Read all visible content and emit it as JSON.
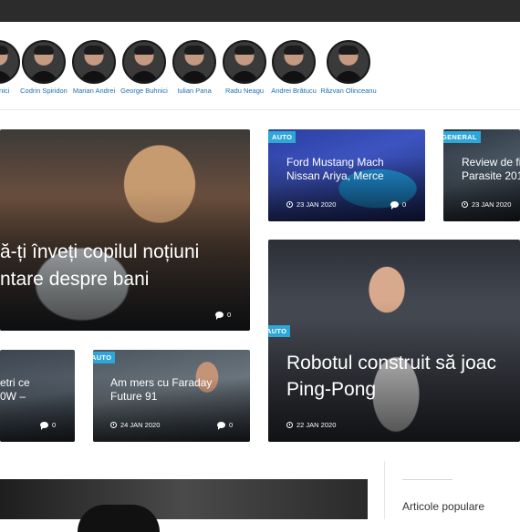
{
  "authors": [
    {
      "name": "Buhnici"
    },
    {
      "name": "Codrin Spiridon"
    },
    {
      "name": "Marian Andrei"
    },
    {
      "name": "George Buhnici"
    },
    {
      "name": "Iulian Pana"
    },
    {
      "name": "Radu Neagu"
    },
    {
      "name": "Andrei Brătucu"
    },
    {
      "name": "Răzvan Olinceanu"
    }
  ],
  "articles": {
    "main": {
      "title_line1": "ă-ți înveți copilul noțiuni",
      "title_line2": "ntare despre bani",
      "comments": "0"
    },
    "ford": {
      "tag": "AUTO",
      "title_line1": "Ford Mustang Mach",
      "title_line2": "Nissan Ariya, Merce",
      "date": "23 JAN 2020",
      "comments": "0"
    },
    "general": {
      "tag": "GENERAL",
      "title_line1": "Review de fi",
      "title_line2": "Parasite 201",
      "date": "23 JAN 2020"
    },
    "robot": {
      "tag": "AUTO",
      "title_line1": "Robotul construit să joac",
      "title_line2": "Ping-Pong",
      "date": "22 JAN 2020"
    },
    "street": {
      "title_line1": "etri ce",
      "title_line2": "0W –",
      "comments": "0"
    },
    "faraday": {
      "tag": "AUTO",
      "title_line1": "Am mers cu Faraday",
      "title_line2": "Future 91",
      "date": "24 JAN 2020",
      "comments": "0"
    }
  },
  "sidebar": {
    "popular_title": "Articole populare"
  },
  "colors": {
    "accent": "#2ea6d8",
    "author_link": "#1f6fb2",
    "topbar": "#2c2c2c"
  },
  "icons": [
    "clock-icon",
    "comment-icon"
  ]
}
